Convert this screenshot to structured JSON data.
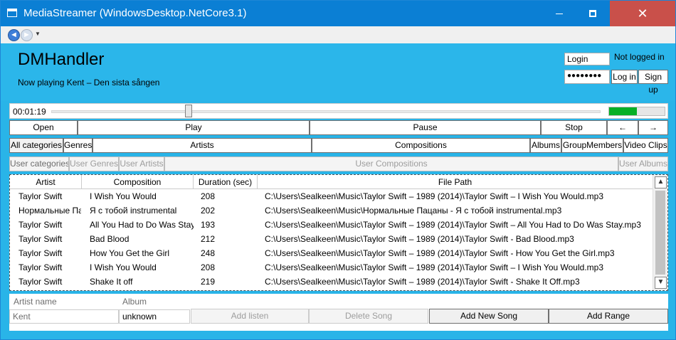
{
  "window": {
    "title": "MediaStreamer (WindowsDesktop.NetCore3.1)",
    "close_glyph": "✕"
  },
  "nav": {
    "back_glyph": "◄",
    "forward_glyph": "►",
    "dropdown_glyph": "▼"
  },
  "header": {
    "app_name": "DMHandler",
    "now_playing": "Now playing Kent – Den sista sången",
    "login_value": "Login",
    "login_status": "Not logged in",
    "password_mask": "●●●●●●●●",
    "login_button": "Log in",
    "signup_button": "Sign up"
  },
  "player": {
    "time": "00:01:19",
    "seek_fraction": 0.25,
    "volume_fraction": 0.5
  },
  "controls": {
    "open": "Open",
    "play": "Play",
    "pause": "Pause",
    "stop": "Stop",
    "prev": "←",
    "next": "→"
  },
  "categories": {
    "all": "All categories",
    "genres": "Genres",
    "artists": "Artists",
    "compositions": "Compositions",
    "albums": "Albums",
    "group_members": "GroupMembers",
    "video_clips": "Video Clips"
  },
  "user_categories": {
    "user": "User categories",
    "genres": "User Genres",
    "artists": "User Artists",
    "compositions": "User Compositions",
    "albums": "User Albums"
  },
  "grid": {
    "headers": {
      "artist": "Artist",
      "composition": "Composition",
      "duration": "Duration (sec)",
      "path": "File Path"
    },
    "rows": [
      {
        "artist": "Taylor Swift",
        "composition": "I Wish You Would",
        "duration": "208",
        "path": "C:\\Users\\Sealkeen\\Music\\Taylor Swift – 1989 (2014)\\Taylor Swift – I Wish You Would.mp3"
      },
      {
        "artist": "Нормальные Па",
        "composition": "Я с тобой instrumental",
        "duration": "202",
        "path": "C:\\Users\\Sealkeen\\Music\\Нормальные Пацаны - Я с тобой instrumental.mp3"
      },
      {
        "artist": "Taylor Swift",
        "composition": "All You Had to Do Was Stay",
        "duration": "193",
        "path": "C:\\Users\\Sealkeen\\Music\\Taylor Swift – 1989 (2014)\\Taylor Swift – All You Had to Do Was Stay.mp3"
      },
      {
        "artist": "Taylor Swift",
        "composition": "Bad Blood",
        "duration": "212",
        "path": "C:\\Users\\Sealkeen\\Music\\Taylor Swift – 1989 (2014)\\Taylor Swift - Bad Blood.mp3"
      },
      {
        "artist": "Taylor Swift",
        "composition": "How You Get the Girl",
        "duration": "248",
        "path": "C:\\Users\\Sealkeen\\Music\\Taylor Swift – 1989 (2014)\\Taylor Swift - How You Get the Girl.mp3"
      },
      {
        "artist": "Taylor Swift",
        "composition": "I Wish You Would",
        "duration": "208",
        "path": "C:\\Users\\Sealkeen\\Music\\Taylor Swift – 1989 (2014)\\Taylor Swift – I Wish You Would.mp3"
      },
      {
        "artist": "Taylor Swift",
        "composition": "Shake It off",
        "duration": "219",
        "path": "C:\\Users\\Sealkeen\\Music\\Taylor Swift – 1989 (2014)\\Taylor Swift - Shake It Off.mp3"
      }
    ],
    "scroll_up_glyph": "▲",
    "scroll_down_glyph": "▼"
  },
  "form": {
    "artist_label": "Artist name",
    "album_label": "Album",
    "artist_value": "Kent",
    "album_value": "unknown",
    "add_listen": "Add listen",
    "delete_song": "Delete Song",
    "add_new_song": "Add New Song",
    "add_range": "Add Range"
  },
  "colors": {
    "titlebar": "#0b7fd4",
    "background": "#29b4e8",
    "close": "#c9504a",
    "volume": "#06b025"
  }
}
